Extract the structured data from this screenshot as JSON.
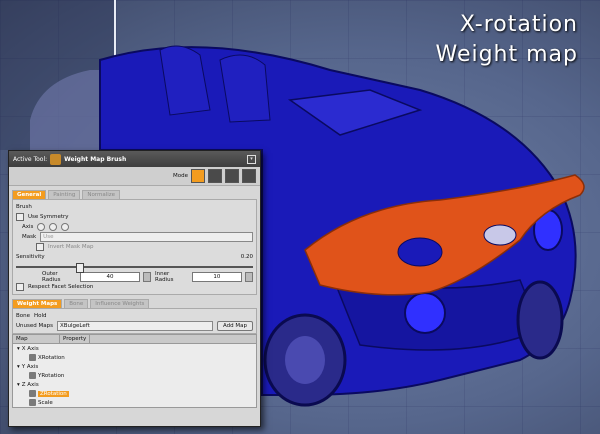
{
  "overlay": {
    "line1": "X-rotation",
    "line2": "Weight  map"
  },
  "panel": {
    "active_tool_label": "Active Tool:",
    "tool_name": "Weight Map Brush",
    "mode_label": "Mode",
    "tabs": [
      "General",
      "Painting",
      "Normalize"
    ],
    "brush": {
      "section_label": "Brush",
      "use_symmetry": "Use Symmetry",
      "axis_label": "Axis",
      "mask_label": "Mask",
      "mask_placeholder": "Use",
      "invert_mask": "Invert Mask Map",
      "sensitivity_label": "Sensitivity",
      "sensitivity_value": "0.20",
      "outer_radius_label": "Outer Radius",
      "outer_radius_value": "40",
      "inner_radius_label": "Inner Radius",
      "inner_radius_value": "10",
      "respect_facet": "Respect Facet Selection"
    },
    "weight_tabs": [
      "Weight Maps",
      "Bone",
      "Influence Weights"
    ],
    "sub_tabs": [
      "Bone",
      "Hold"
    ],
    "unused_maps_label": "Unused Maps",
    "unused_maps_value": "XBulgeLeft",
    "add_map_label": "Add Map",
    "tree_headers": [
      "Map",
      "Property"
    ],
    "tree": [
      {
        "label": "X Axis",
        "level": 0
      },
      {
        "label": "XRotation",
        "level": 1
      },
      {
        "label": "Y Axis",
        "level": 0
      },
      {
        "label": "YRotation",
        "level": 1
      },
      {
        "label": "Z Axis",
        "level": 0
      },
      {
        "label": "ZRotation",
        "level": 1,
        "selected": true
      },
      {
        "label": "Scale",
        "level": 1
      }
    ]
  },
  "colors": {
    "accent": "#f39c1f",
    "car_body": "#1a1ab8",
    "hood": "#e0531a"
  }
}
